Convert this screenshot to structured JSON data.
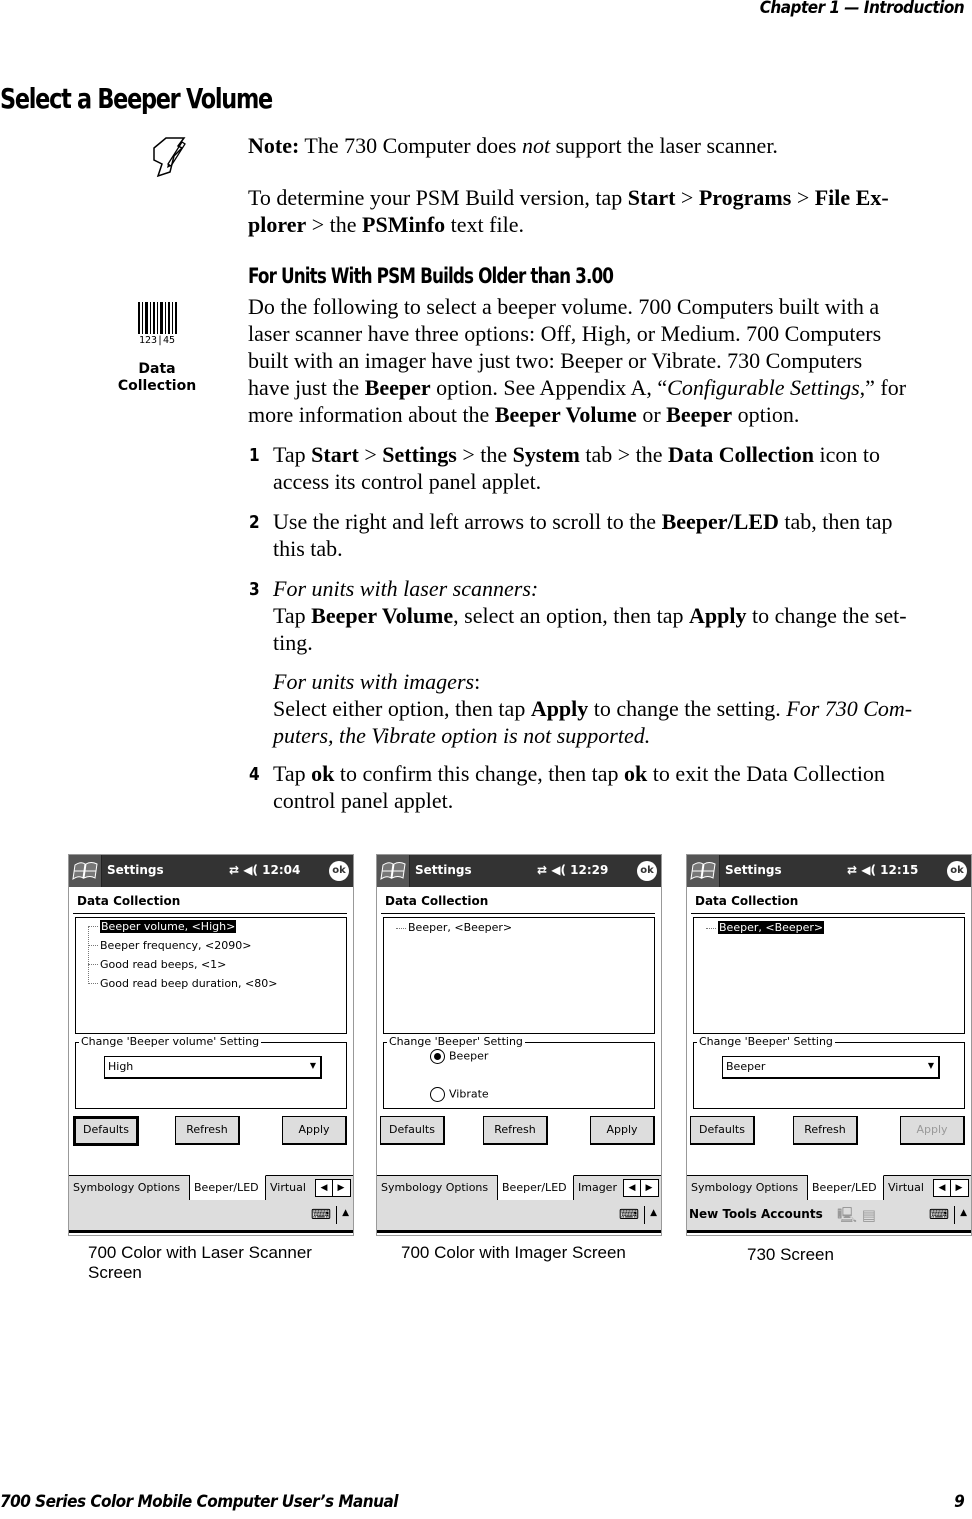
{
  "header": {
    "chapter": "Chapter  1  —  Introduction"
  },
  "footer": {
    "manual_title": "700 Series Color Mobile Computer User’s Manual",
    "page_number": "9"
  },
  "section_title": "Select a Beeper Volume",
  "note": {
    "icon": "note-pencil-icon",
    "label": "Note:",
    "text_before": " The 730 Computer does ",
    "emph": "not",
    "text_after": " support the laser scanner."
  },
  "psm_para": {
    "t1": "To determine your PSM Build version, tap ",
    "start": "Start",
    "sep1": " > ",
    "programs": "Programs",
    "sep2": " > ",
    "file_explorer_1": "File Ex-",
    "file_explorer_2": "plorer",
    "t2": " > the ",
    "psminfo": "PSMinfo",
    "t3": " text file."
  },
  "subsection_title": "For Units With PSM Builds Older than 3.00",
  "data_collection_icon": {
    "label_line1": "Data",
    "label_line2": "Collection",
    "barcode_digits": "123 45"
  },
  "intro": {
    "l1": "Do the following to select a beeper volume. 700 Computers built with a",
    "l2": "laser scanner have three options: Off, High, or Medium. 700 Computers",
    "l3": "built with an imager have just two: Beeper or Vibrate. 730 Computers",
    "l4a": "have just the ",
    "l4b": "Beeper",
    "l4c": " option. See Appendix A, “",
    "l4d": "Configurable Settings",
    "l4e": ",” for",
    "l5a": "more information about the ",
    "l5b": "Beeper Volume",
    "l5c": " or ",
    "l5d": "Beeper",
    "l5e": " option."
  },
  "steps": [
    {
      "num": "1",
      "a": "Tap ",
      "b": "Start",
      "c": " > ",
      "d": "Settings",
      "e": " > the ",
      "f": "System",
      "g": " tab > the ",
      "h": "Data Collection",
      "i": " icon to",
      "line2": "access its control panel applet."
    },
    {
      "num": "2",
      "a": "Use the right and left arrows to scroll to the ",
      "b": "Beeper/LED",
      "c": " tab, then tap",
      "line2": "this tab."
    },
    {
      "num": "3",
      "laser_label": "For units with laser scanners:",
      "a": "Tap ",
      "b": "Beeper Volume",
      "c": ", select an option, then tap ",
      "d": "Apply",
      "e": " to change the set-",
      "line3": "ting.",
      "imager_label": "For units with imagers",
      "imager_colon": ":",
      "f": "Select either option, then tap ",
      "g": "Apply",
      "h": " to change the setting. ",
      "i": "For 730 Com-",
      "j": "puters, the Vibrate option is not supported."
    },
    {
      "num": "4",
      "a": "Tap ",
      "b": "ok",
      "c": " to confirm this change, then tap ",
      "d": "ok",
      "e": " to exit the Data Collection",
      "line2": "control panel applet."
    }
  ],
  "screens": [
    {
      "caption": "700 Color with Laser Scanner Screen",
      "caption_l1": "700 Color with Laser Scanner",
      "caption_l2": "Screen",
      "title": "Settings",
      "time": "12:04",
      "ok": "ok",
      "app_title": "Data Collection",
      "tree_items": [
        "Beeper volume, <High>",
        "Beeper frequency, <2090>",
        "Good read beeps, <1>",
        "Good read beep duration, <80>"
      ],
      "selected_index": 0,
      "group_label": "Change 'Beeper volume' Setting",
      "combo_value": "High",
      "buttons": [
        "Defaults",
        "Refresh",
        "Apply"
      ],
      "tabs": [
        "Symbology Options",
        "Beeper/LED",
        "Virtual ’"
      ],
      "active_tab": "Beeper/LED"
    },
    {
      "caption": "700 Color with Imager Screen",
      "title": "Settings",
      "time": "12:29",
      "ok": "ok",
      "app_title": "Data Collection",
      "tree_items": [
        "Beeper, <Beeper>"
      ],
      "group_label": "Change 'Beeper' Setting",
      "radio_options": [
        "Beeper",
        "Vibrate"
      ],
      "radio_selected": "Beeper",
      "buttons": [
        "Defaults",
        "Refresh",
        "Apply"
      ],
      "tabs": [
        "Symbology Options",
        "Beeper/LED",
        "Imager"
      ],
      "active_tab": "Beeper/LED"
    },
    {
      "caption": "730 Screen",
      "title": "Settings",
      "time": "12:15",
      "ok": "ok",
      "app_title": "Data Collection",
      "tree_items": [
        "Beeper, <Beeper>"
      ],
      "selected_index": 0,
      "group_label": "Change 'Beeper' Setting",
      "combo_value": "Beeper",
      "buttons": [
        "Defaults",
        "Refresh",
        "Apply"
      ],
      "apply_disabled": true,
      "tabs": [
        "Symbology Options",
        "Beeper/LED",
        "Virtual ’"
      ],
      "active_tab": "Beeper/LED",
      "menu_items": [
        "New",
        "Tools",
        "Accounts"
      ]
    }
  ]
}
